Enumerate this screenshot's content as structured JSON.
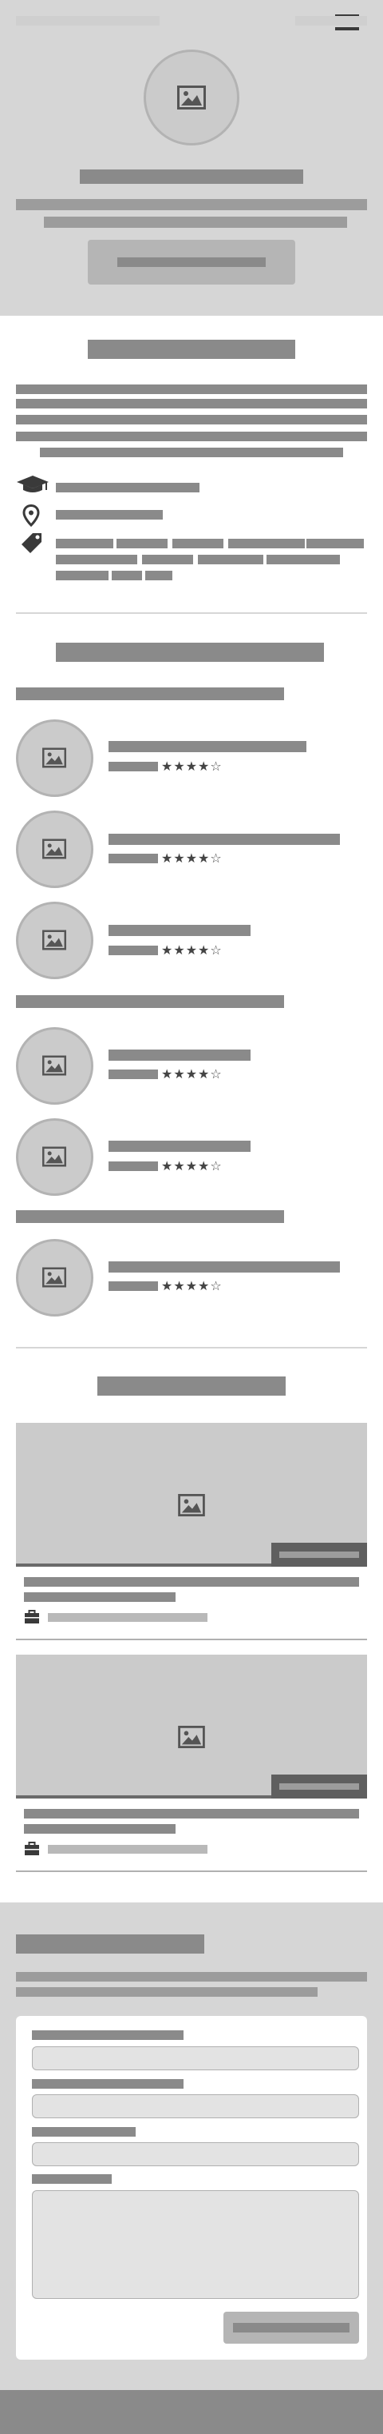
{
  "header": {
    "menu_icon": "hamburger-menu-icon",
    "avatar_icon": "image-placeholder-icon"
  },
  "about": {
    "icons": [
      "graduation-cap-icon",
      "map-pin-icon",
      "tag-icon"
    ]
  },
  "reviews": {
    "groups": [
      {
        "items": [
          {
            "rating": "★★★★☆"
          },
          {
            "rating": "★★★★☆"
          },
          {
            "rating": "★★★★☆"
          }
        ]
      },
      {
        "items": [
          {
            "rating": "★★★★☆"
          },
          {
            "rating": "★★★★☆"
          }
        ]
      },
      {
        "items": [
          {
            "rating": "★★★★☆"
          }
        ]
      }
    ]
  },
  "projects": {
    "card_icon": "briefcase-icon"
  },
  "colors": {
    "hero_bg": "#d6d6d6",
    "placeholder_text": "#8a8a8a",
    "footer_bg": "#8a8a8a",
    "card_tag": "#5f5f5f"
  }
}
